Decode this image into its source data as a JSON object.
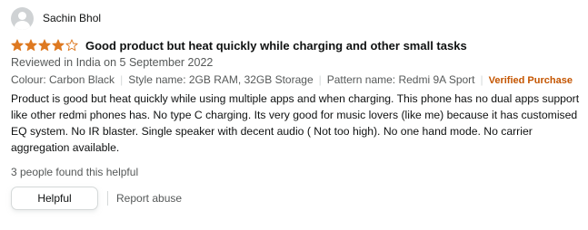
{
  "reviewer": {
    "name": "Sachin Bhol",
    "avatar_icon": "person-icon"
  },
  "rating": {
    "value": 4,
    "max": 5,
    "star_color": "#de7921"
  },
  "review": {
    "title": "Good product but heat quickly while charging and other small tasks",
    "date_line": "Reviewed in India on 5 September 2022",
    "attributes": [
      "Colour: Carbon Black",
      "Style name: 2GB RAM, 32GB Storage",
      "Pattern name: Redmi 9A Sport"
    ],
    "verified_label": "Verified Purchase",
    "body": "Product is good but heat quickly while using multiple apps and when charging. This phone has no dual apps support like other redmi phones has. No type C charging. Its very good for music lovers (like me) because it has customised EQ system. No IR blaster. Single speaker with decent audio ( Not too high). No one hand mode. No carrier aggregation available.",
    "helpful_count": "3 people found this helpful"
  },
  "actions": {
    "helpful_label": "Helpful",
    "report_label": "Report abuse"
  },
  "colors": {
    "verified": "#c45500",
    "secondary_text": "#565959",
    "border": "#d5d9d9"
  }
}
